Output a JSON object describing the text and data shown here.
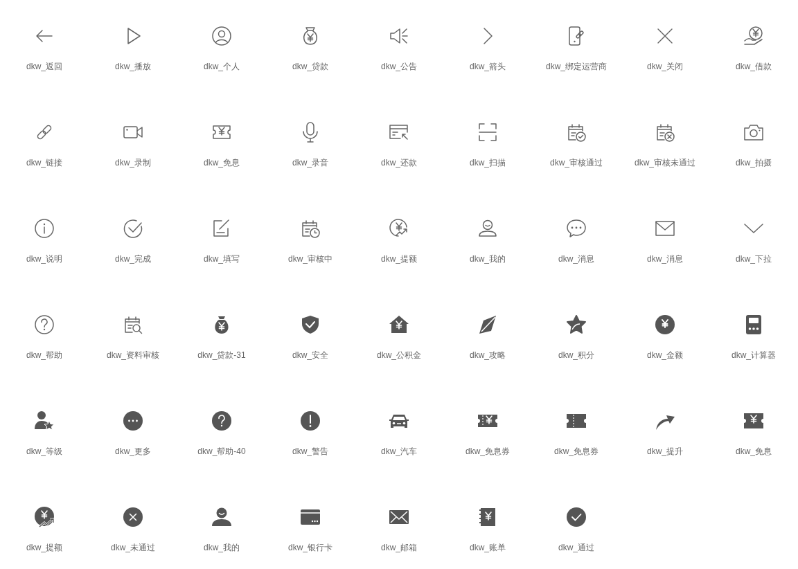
{
  "icons": [
    {
      "label": "dkw_返回",
      "kind": "back"
    },
    {
      "label": "dkw_播放",
      "kind": "play"
    },
    {
      "label": "dkw_个人",
      "kind": "person"
    },
    {
      "label": "dkw_贷款",
      "kind": "moneybag"
    },
    {
      "label": "dkw_公告",
      "kind": "speaker"
    },
    {
      "label": "dkw_箭头",
      "kind": "chevronright"
    },
    {
      "label": "dkw_绑定运营商",
      "kind": "phonelink"
    },
    {
      "label": "dkw_关闭",
      "kind": "close"
    },
    {
      "label": "dkw_借款",
      "kind": "handcoin"
    },
    {
      "label": "dkw_链接",
      "kind": "link"
    },
    {
      "label": "dkw_录制",
      "kind": "video"
    },
    {
      "label": "dkw_免息",
      "kind": "ticketyen"
    },
    {
      "label": "dkw_录音",
      "kind": "mic"
    },
    {
      "label": "dkw_还款",
      "kind": "cardarrow"
    },
    {
      "label": "dkw_扫描",
      "kind": "scan"
    },
    {
      "label": "dkw_审核通过",
      "kind": "calcheck"
    },
    {
      "label": "dkw_审核未通过",
      "kind": "calx"
    },
    {
      "label": "dkw_拍摄",
      "kind": "camera"
    },
    {
      "label": "dkw_说明",
      "kind": "info"
    },
    {
      "label": "dkw_完成",
      "kind": "done"
    },
    {
      "label": "dkw_填写",
      "kind": "edit"
    },
    {
      "label": "dkw_审核中",
      "kind": "calclock"
    },
    {
      "label": "dkw_提额",
      "kind": "yentrend"
    },
    {
      "label": "dkw_我的",
      "kind": "user"
    },
    {
      "label": "dkw_消息",
      "kind": "chat"
    },
    {
      "label": "dkw_消息",
      "kind": "mail"
    },
    {
      "label": "dkw_下拉",
      "kind": "chevrondown"
    },
    {
      "label": "dkw_帮助",
      "kind": "help"
    },
    {
      "label": "dkw_资料审核",
      "kind": "calsearch"
    },
    {
      "label": "dkw_贷款-31",
      "kind": "moneybagfill"
    },
    {
      "label": "dkw_安全",
      "kind": "shield"
    },
    {
      "label": "dkw_公积金",
      "kind": "house"
    },
    {
      "label": "dkw_攻略",
      "kind": "kite"
    },
    {
      "label": "dkw_积分",
      "kind": "star"
    },
    {
      "label": "dkw_金额",
      "kind": "yencircle"
    },
    {
      "label": "dkw_计算器",
      "kind": "calculator"
    },
    {
      "label": "dkw_等级",
      "kind": "personstar"
    },
    {
      "label": "dkw_更多",
      "kind": "more"
    },
    {
      "label": "dkw_帮助-40",
      "kind": "helpfill"
    },
    {
      "label": "dkw_警告",
      "kind": "warning"
    },
    {
      "label": "dkw_汽车",
      "kind": "car"
    },
    {
      "label": "dkw_免息券",
      "kind": "ticketyenfill"
    },
    {
      "label": "dkw_免息券",
      "kind": "ticketfill"
    },
    {
      "label": "dkw_提升",
      "kind": "arrowup"
    },
    {
      "label": "dkw_免息",
      "kind": "ticketyenfill2"
    },
    {
      "label": "dkw_提额",
      "kind": "yentrendfill"
    },
    {
      "label": "dkw_未通过",
      "kind": "xfill"
    },
    {
      "label": "dkw_我的",
      "kind": "userfill"
    },
    {
      "label": "dkw_银行卡",
      "kind": "cardfill"
    },
    {
      "label": "dkw_邮箱",
      "kind": "mailfill"
    },
    {
      "label": "dkw_账单",
      "kind": "bill"
    },
    {
      "label": "dkw_通过",
      "kind": "checkfill"
    }
  ]
}
